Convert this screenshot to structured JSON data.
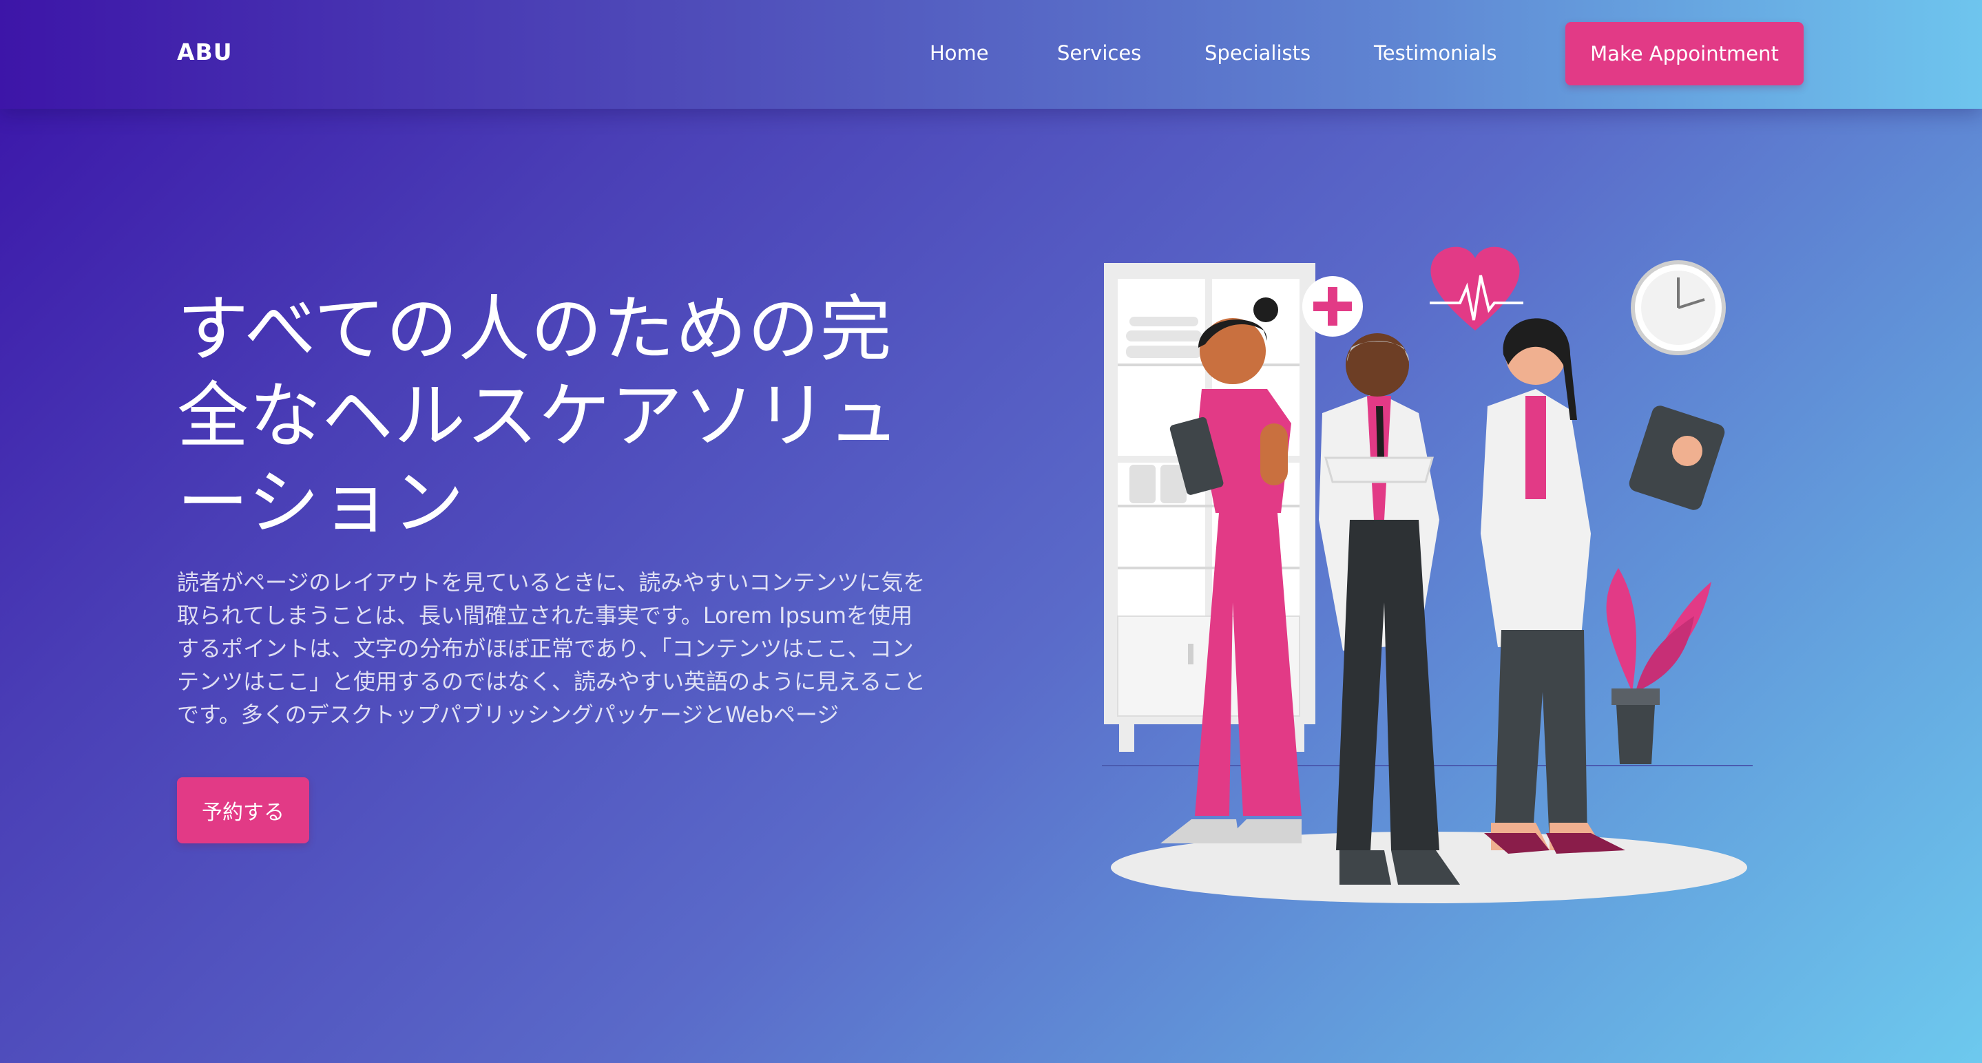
{
  "navbar": {
    "logo": "ABU",
    "links": [
      {
        "label": "Home"
      },
      {
        "label": "Services"
      },
      {
        "label": "Specialists"
      },
      {
        "label": "Testimonials"
      }
    ],
    "cta_label": "Make Appointment"
  },
  "hero": {
    "title": "すべての人のための完全なヘルスケアソリューション",
    "description": "読者がページのレイアウトを見ているときに、読みやすいコンテンツに気を取られてしまうことは、長い間確立された事実です。Lorem Ipsumを使用するポイントは、文字の分布がほぼ正常であり、「コンテンツはここ、コンテンツはここ」と使用するのではなく、読みやすい英語のように見えることです。多くのデスクトップパブリッシングパッケージとWebページ",
    "button_label": "予約する"
  },
  "colors": {
    "accent": "#e23a86",
    "gradient_start": "#3a12a8",
    "gradient_end": "#6dc9ee"
  },
  "icons": [
    "medical-cross-icon",
    "heartbeat-icon",
    "clock-icon"
  ]
}
